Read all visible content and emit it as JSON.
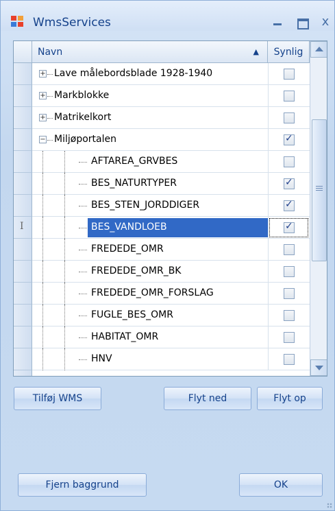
{
  "window": {
    "title": "WmsServices",
    "close_glyph": "x"
  },
  "grid": {
    "headers": {
      "name": "Navn",
      "visible": "Synlig"
    },
    "rows": [
      {
        "label": "Lave målebordsblade 1928-1940",
        "level": 0,
        "expander": "+",
        "checked": false
      },
      {
        "label": "Markblokke",
        "level": 0,
        "expander": "+",
        "checked": false
      },
      {
        "label": "Matrikelkort",
        "level": 0,
        "expander": "+",
        "checked": false
      },
      {
        "label": "Miljøportalen",
        "level": 0,
        "expander": "-",
        "checked": true
      },
      {
        "label": "AFTAREA_GRVBES",
        "level": 1,
        "checked": false
      },
      {
        "label": "BES_NATURTYPER",
        "level": 1,
        "checked": true
      },
      {
        "label": "BES_STEN_JORDDIGER",
        "level": 1,
        "checked": true
      },
      {
        "label": "BES_VANDLOEB",
        "level": 1,
        "checked": true,
        "selected": true
      },
      {
        "label": "FREDEDE_OMR",
        "level": 1,
        "checked": false
      },
      {
        "label": "FREDEDE_OMR_BK",
        "level": 1,
        "checked": false
      },
      {
        "label": "FREDEDE_OMR_FORSLAG",
        "level": 1,
        "checked": false
      },
      {
        "label": "FUGLE_BES_OMR",
        "level": 1,
        "checked": false
      },
      {
        "label": "HABITAT_OMR",
        "level": 1,
        "checked": false
      },
      {
        "label": "HNV",
        "level": 1,
        "checked": false
      }
    ]
  },
  "buttons": {
    "add_wms": "Tilføj WMS",
    "move_down": "Flyt ned",
    "move_up": "Flyt op",
    "remove_background": "Fjern baggrund",
    "ok": "OK"
  },
  "colors": {
    "selection": "#3169c6",
    "accent": "#15428b"
  }
}
